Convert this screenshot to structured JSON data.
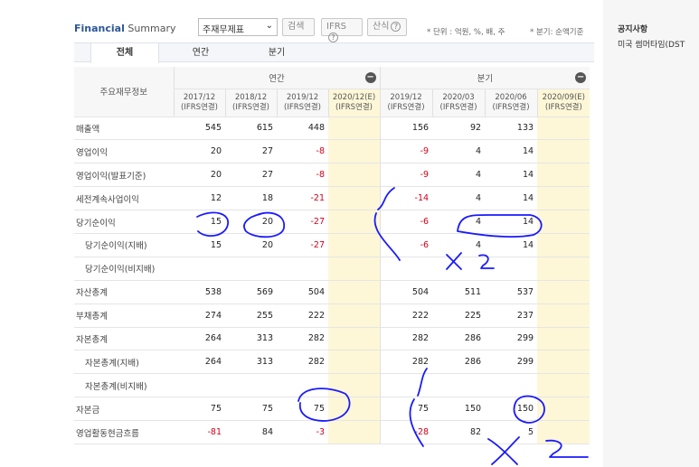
{
  "header": {
    "title_a": "Financial",
    "title_b": " Summary",
    "select_value": "주재무제표",
    "search_label": "검색",
    "ifrs_label": "IFRS",
    "calc_label": "산식",
    "help_glyph": "?",
    "unit_note": "* 단위 : 억원, %, 배, 주",
    "period_note": "* 분기: 순액기준"
  },
  "tabs": [
    {
      "label": "전체",
      "active": true
    },
    {
      "label": "연간",
      "active": false
    },
    {
      "label": "분기",
      "active": false
    }
  ],
  "table": {
    "corner_label": "주요재무정보",
    "group_annual": "연간",
    "group_quarter": "분기",
    "columns": [
      {
        "period": "2017/12",
        "basis": "(IFRS연결)"
      },
      {
        "period": "2018/12",
        "basis": "(IFRS연결)"
      },
      {
        "period": "2019/12",
        "basis": "(IFRS연결)"
      },
      {
        "period": "2020/12(E)",
        "basis": "(IFRS연결)"
      },
      {
        "period": "2019/12",
        "basis": "(IFRS연결)"
      },
      {
        "period": "2020/03",
        "basis": "(IFRS연결)"
      },
      {
        "period": "2020/06",
        "basis": "(IFRS연결)"
      },
      {
        "period": "2020/09(E)",
        "basis": "(IFRS연결)"
      }
    ],
    "rows": [
      {
        "label": "매출액",
        "sub": false,
        "values": [
          "545",
          "615",
          "448",
          "",
          "156",
          "92",
          "133",
          ""
        ]
      },
      {
        "label": "영업이익",
        "sub": false,
        "values": [
          "20",
          "27",
          "-8",
          "",
          "-9",
          "4",
          "14",
          ""
        ]
      },
      {
        "label": "영업이익(발표기준)",
        "sub": false,
        "values": [
          "20",
          "27",
          "-8",
          "",
          "-9",
          "4",
          "14",
          ""
        ]
      },
      {
        "label": "세전계속사업이익",
        "sub": false,
        "values": [
          "12",
          "18",
          "-21",
          "",
          "-14",
          "4",
          "14",
          ""
        ]
      },
      {
        "label": "당기순이익",
        "sub": false,
        "values": [
          "15",
          "20",
          "-27",
          "",
          "-6",
          "4",
          "14",
          ""
        ]
      },
      {
        "label": "당기순이익(지배)",
        "sub": true,
        "values": [
          "15",
          "20",
          "-27",
          "",
          "-6",
          "4",
          "14",
          ""
        ]
      },
      {
        "label": "당기순이익(비지배)",
        "sub": true,
        "values": [
          "",
          "",
          "",
          "",
          "",
          "",
          "",
          ""
        ]
      },
      {
        "label": "자산총계",
        "sub": false,
        "values": [
          "538",
          "569",
          "504",
          "",
          "504",
          "511",
          "537",
          ""
        ]
      },
      {
        "label": "부채총계",
        "sub": false,
        "values": [
          "274",
          "255",
          "222",
          "",
          "222",
          "225",
          "237",
          ""
        ]
      },
      {
        "label": "자본총계",
        "sub": false,
        "values": [
          "264",
          "313",
          "282",
          "",
          "282",
          "286",
          "299",
          ""
        ]
      },
      {
        "label": "자본총계(지배)",
        "sub": true,
        "values": [
          "264",
          "313",
          "282",
          "",
          "282",
          "286",
          "299",
          ""
        ]
      },
      {
        "label": "자본총계(비지배)",
        "sub": true,
        "values": [
          "",
          "",
          "",
          "",
          "",
          "",
          "",
          ""
        ]
      },
      {
        "label": "자본금",
        "sub": false,
        "values": [
          "75",
          "75",
          "75",
          "",
          "75",
          "150",
          "150",
          ""
        ]
      },
      {
        "label": "영업활동현금흐름",
        "sub": false,
        "values": [
          "-81",
          "84",
          "-3",
          "",
          "-28",
          "82",
          "5",
          ""
        ]
      }
    ]
  },
  "side": {
    "title": "공지사항",
    "item": "미국 썸머타임(DST"
  },
  "colors": {
    "accent": "#2b5797",
    "negative": "#d0021b",
    "estimate_bg": "#fdf7d8",
    "ink": "#1a1aff"
  }
}
